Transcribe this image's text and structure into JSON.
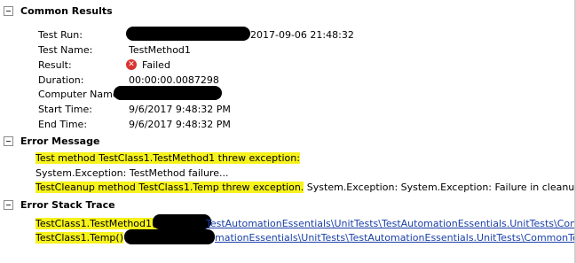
{
  "sections": {
    "common": {
      "title": "Common Results"
    },
    "error_message": {
      "title": "Error Message"
    },
    "stack_trace": {
      "title": "Error Stack Trace"
    }
  },
  "common_results": {
    "test_run_label": "Test Run:",
    "test_run_value": "2017-09-06 21:48:32",
    "test_name_label": "Test Name:",
    "test_name_value": "TestMethod1",
    "result_label": "Result:",
    "result_value": "Failed",
    "duration_label": "Duration:",
    "duration_value": "00:00:00.0087298",
    "computer_name_label": "Computer Name:",
    "start_time_label": "Start Time:",
    "start_time_value": "9/6/2017 9:48:32 PM",
    "end_time_label": "End Time:",
    "end_time_value": "9/6/2017 9:48:32 PM"
  },
  "error_message": {
    "line1": "Test method TestClass1.TestMethod1 threw exception:",
    "line2": "System.Exception: TestMethod failure...",
    "line3_highlighted": "TestCleanup method TestClass1.Temp threw exception.",
    "line3_rest": " System.Exception: System.Exception: Failure in cleanup."
  },
  "stack_trace": {
    "frame1_method": "TestClass1.TestMethod1()",
    "frame1_path": "TestAutomationEssentials\\UnitTests\\TestAutomationEssentials.UnitTests\\Comm",
    "frame2_method": "TestClass1.Temp()",
    "frame2_path": "mationEssentials\\UnitTests\\TestAutomationEssentials.UnitTests\\CommonTest"
  },
  "colors": {
    "highlight": "#f6f21b",
    "link": "#1a3fa8",
    "fail_icon": "#d9322f"
  },
  "icons": {
    "toggle": "collapse-minus-icon",
    "result": "failed-x-icon"
  }
}
